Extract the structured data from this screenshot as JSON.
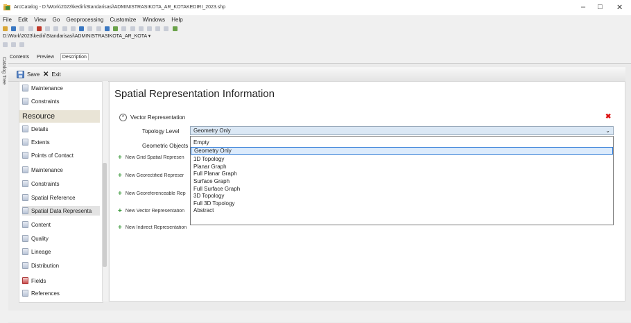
{
  "window": {
    "title": "ArcCatalog - D:\\Work\\2023\\kediri\\Standarisasi\\ADMINISTRASIKOTA_AR_KOTAKEDIRI_2023.shp",
    "minimize": "–",
    "maximize": "□",
    "close": "✕"
  },
  "menu": [
    "File",
    "Edit",
    "View",
    "Go",
    "Geoprocessing",
    "Customize",
    "Windows",
    "Help"
  ],
  "location": "D:\\Work\\2023\\kediri\\Standarisasi\\ADMINISTRASIKOTA_AR_KOTA",
  "catalog_tree_label": "Catalog Tree",
  "tabs": [
    "Contents",
    "Preview",
    "Description"
  ],
  "active_tab": "Description",
  "editbar": {
    "save": "Save",
    "exit": "Exit"
  },
  "nav": {
    "top_items": [
      "Maintenance",
      "Constraints"
    ],
    "resource_header": "Resource",
    "items": [
      {
        "label": "Details",
        "icon": "document-icon"
      },
      {
        "label": "Extents",
        "icon": "document-icon"
      },
      {
        "label": "Points of Contact",
        "icon": "document-icon"
      },
      {
        "label": "Maintenance",
        "icon": "document-icon"
      },
      {
        "label": "Constraints",
        "icon": "document-icon"
      },
      {
        "label": "Spatial Reference",
        "icon": "document-icon"
      },
      {
        "label": "Spatial Data Representa",
        "icon": "document-icon",
        "selected": true
      },
      {
        "label": "Content",
        "icon": "document-icon"
      },
      {
        "label": "Quality",
        "icon": "document-icon"
      },
      {
        "label": "Lineage",
        "icon": "document-icon"
      },
      {
        "label": "Distribution",
        "icon": "document-icon"
      },
      {
        "label": "Fields",
        "icon": "document-error-icon"
      },
      {
        "label": "References",
        "icon": "document-icon"
      }
    ]
  },
  "main": {
    "title": "Spatial Representation Information",
    "vector_rep_label": "Vector Representation",
    "topology_label": "Topology Level",
    "topology_value": "Geometry Only",
    "geometric_objects_label": "Geometric Objects",
    "dropdown_options": [
      "Empty",
      "Geometry Only",
      "1D Topology",
      "Planar Graph",
      "Full Planar Graph",
      "Surface Graph",
      "Full Surface Graph",
      "3D Topology",
      "Full 3D Topology",
      "Abstract"
    ],
    "new_links": [
      "New Grid Spatial Represen",
      "New Georectified Represer",
      "New Georeferenceable Rep",
      "New Vector Representation",
      "New Indirect Representation"
    ]
  },
  "colors": {
    "accent_blue": "#2f7bd6",
    "selection_fill": "#dcebfc",
    "delete_red": "#dd1111",
    "add_green": "#3c9a3c"
  }
}
